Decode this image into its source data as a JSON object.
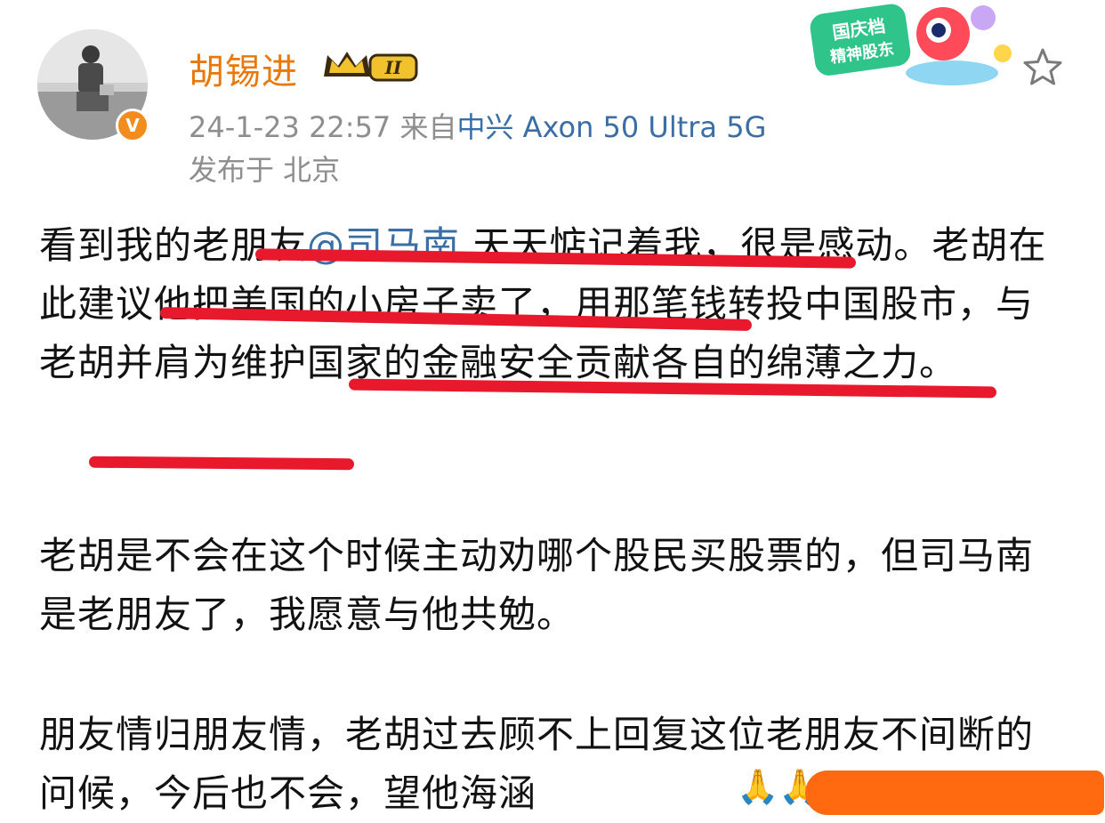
{
  "post": {
    "username": "胡锡进",
    "level_badge": "II",
    "timestamp": "24-1-23 22:57",
    "source_prefix": "来自",
    "source_device": "中兴 Axon 50 Ultra 5G",
    "location": "发布于 北京",
    "sticker_text": "国庆档 精神股东",
    "para1_pre": "看到我的老朋友",
    "mention": "@司马南",
    "para1_post": " 天天惦记着我，很是感动。老胡在此建议他把美国的小房子卖了，用那笔钱转投中国股市，与老胡并肩为维护国家的金融安全贡献各自的绵薄之力。",
    "para2": "老胡是不会在这个时候主动劝哪个股民买股票的，但司马南是老朋友了，我愿意与他共勉。",
    "para3": "朋友情归朋友情，老胡过去顾不上回复这位老朋友不间断的问候，今后也不会，望他海涵"
  },
  "colors": {
    "username": "#e8780a",
    "link": "#3a6ea5",
    "underline": "#e8192c",
    "meta": "#8e8e8e",
    "redaction": "#ff6a10"
  },
  "icons": [
    "avatar",
    "verified-v-icon",
    "crown-level-icon",
    "festival-sticker",
    "star-icon",
    "hands-emoji-icon"
  ]
}
